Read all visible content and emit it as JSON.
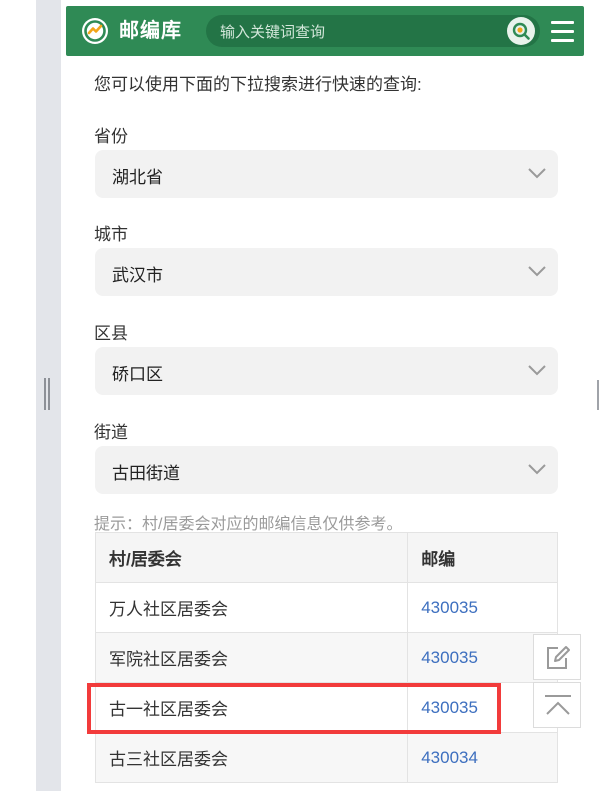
{
  "header": {
    "brand": "邮编库",
    "search_placeholder": "输入关键词查询"
  },
  "intro_text": "您可以使用下面的下拉搜索进行快速的查询:",
  "filters": [
    {
      "label": "省份",
      "value": "湖北省"
    },
    {
      "label": "城市",
      "value": "武汉市"
    },
    {
      "label": "区县",
      "value": "硚口区"
    },
    {
      "label": "街道",
      "value": "古田街道"
    }
  ],
  "hint": "提示：村/居委会对应的邮编信息仅供参考。",
  "table": {
    "headers": [
      "村/居委会",
      "邮编"
    ],
    "rows": [
      {
        "name": "万人社区居委会",
        "zip": "430035"
      },
      {
        "name": "军院社区居委会",
        "zip": "430035"
      },
      {
        "name": "古一社区居委会",
        "zip": "430035"
      },
      {
        "name": "古三社区居委会",
        "zip": "430034"
      }
    ]
  },
  "colors": {
    "header_green": "#2f8a55",
    "zip_link": "#3d6fbf",
    "highlight_red": "#f23b3b"
  },
  "icons": [
    "logo-icon",
    "search-icon",
    "menu-icon",
    "chevron-down-icon",
    "edit-icon",
    "back-to-top-icon"
  ]
}
